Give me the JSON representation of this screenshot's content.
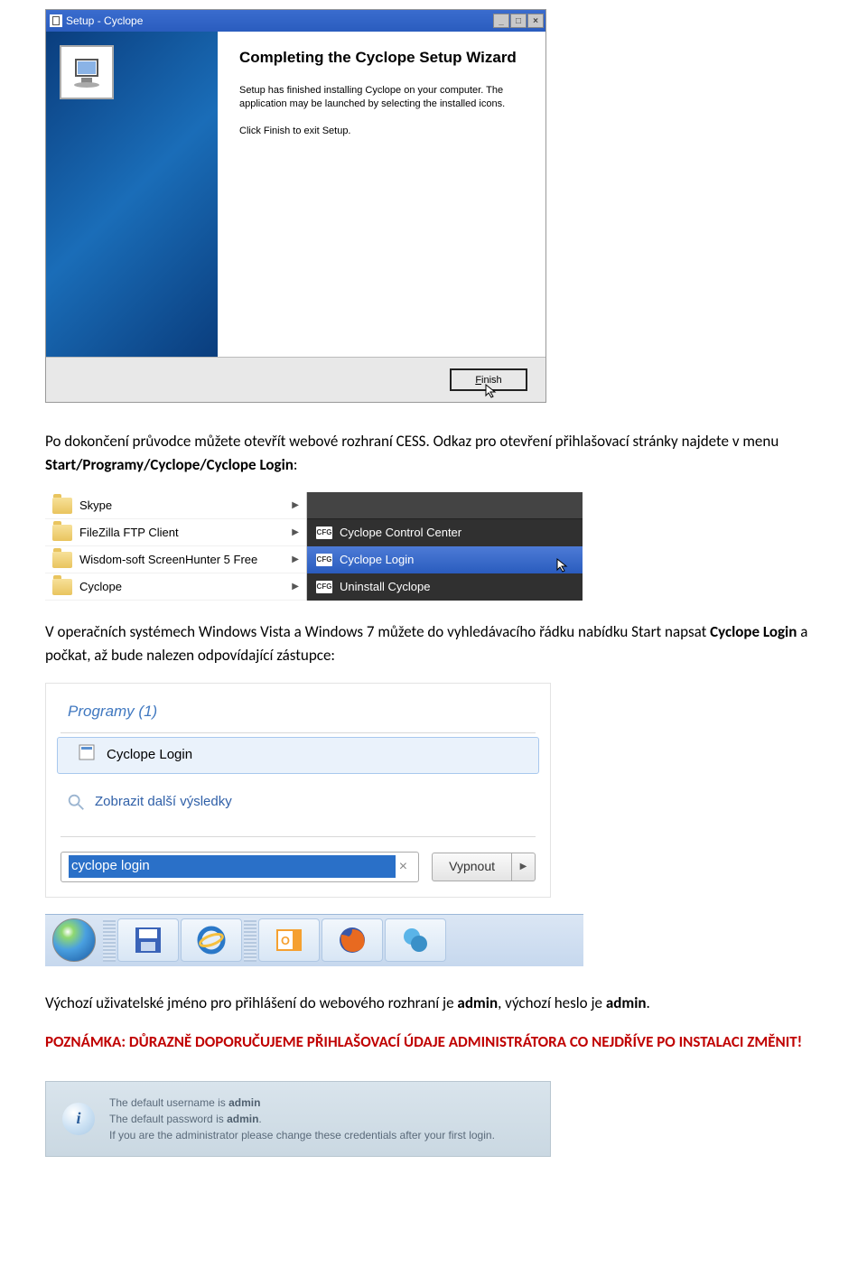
{
  "wizard": {
    "title": "Setup - Cyclope",
    "heading": "Completing the Cyclope Setup Wizard",
    "text1": "Setup has finished installing Cyclope on your computer. The application may be launched by selecting the installed icons.",
    "text2": "Click Finish to exit Setup.",
    "finish_label": "Finish"
  },
  "doc": {
    "para1_a": "Po dokončení průvodce můžete otevřít webové rozhraní CESS. Odkaz pro otevření přihlašovací stránky najdete v menu ",
    "para1_b": "Start/Programy/Cyclope/Cyclope Login",
    "para1_c": ":",
    "para2_a": "V operačních systémech Windows Vista a Windows 7 můžete do vyhledávacího řádku nabídku Start napsat ",
    "para2_b": "Cyclope Login",
    "para2_c": " a počkat, až bude nalezen odpovídající zástupce:",
    "para3_a": "Výchozí uživatelské jméno pro přihlášení do webového rozhraní je ",
    "para3_b": "admin",
    "para3_c": ", výchozí heslo je ",
    "para3_d": "admin",
    "para3_e": ".",
    "note": "POZNÁMKA: DŮRAZNĚ DOPORUČUJEME PŘIHLAŠOVACÍ ÚDAJE ADMINISTRÁTORA CO NEJDŘÍVE PO INSTALACI ZMĚNIT!"
  },
  "startmenu": {
    "left_items": [
      "Skype",
      "FileZilla FTP Client",
      "Wisdom-soft ScreenHunter 5 Free",
      "Cyclope"
    ],
    "right_items": [
      "Cyclope Control Center",
      "Cyclope Login",
      "Uninstall Cyclope"
    ]
  },
  "win7": {
    "header": "Programy (1)",
    "result": "Cyclope Login",
    "more": "Zobrazit další výsledky",
    "search_value": "cyclope login",
    "shutdown": "Vypnout"
  },
  "infobox": {
    "line1_a": "The default username is ",
    "line1_b": "admin",
    "line2_a": "The default password is ",
    "line2_b": "admin",
    "line2_c": ".",
    "line3": "If you are the administrator please change these credentials after your first login."
  }
}
